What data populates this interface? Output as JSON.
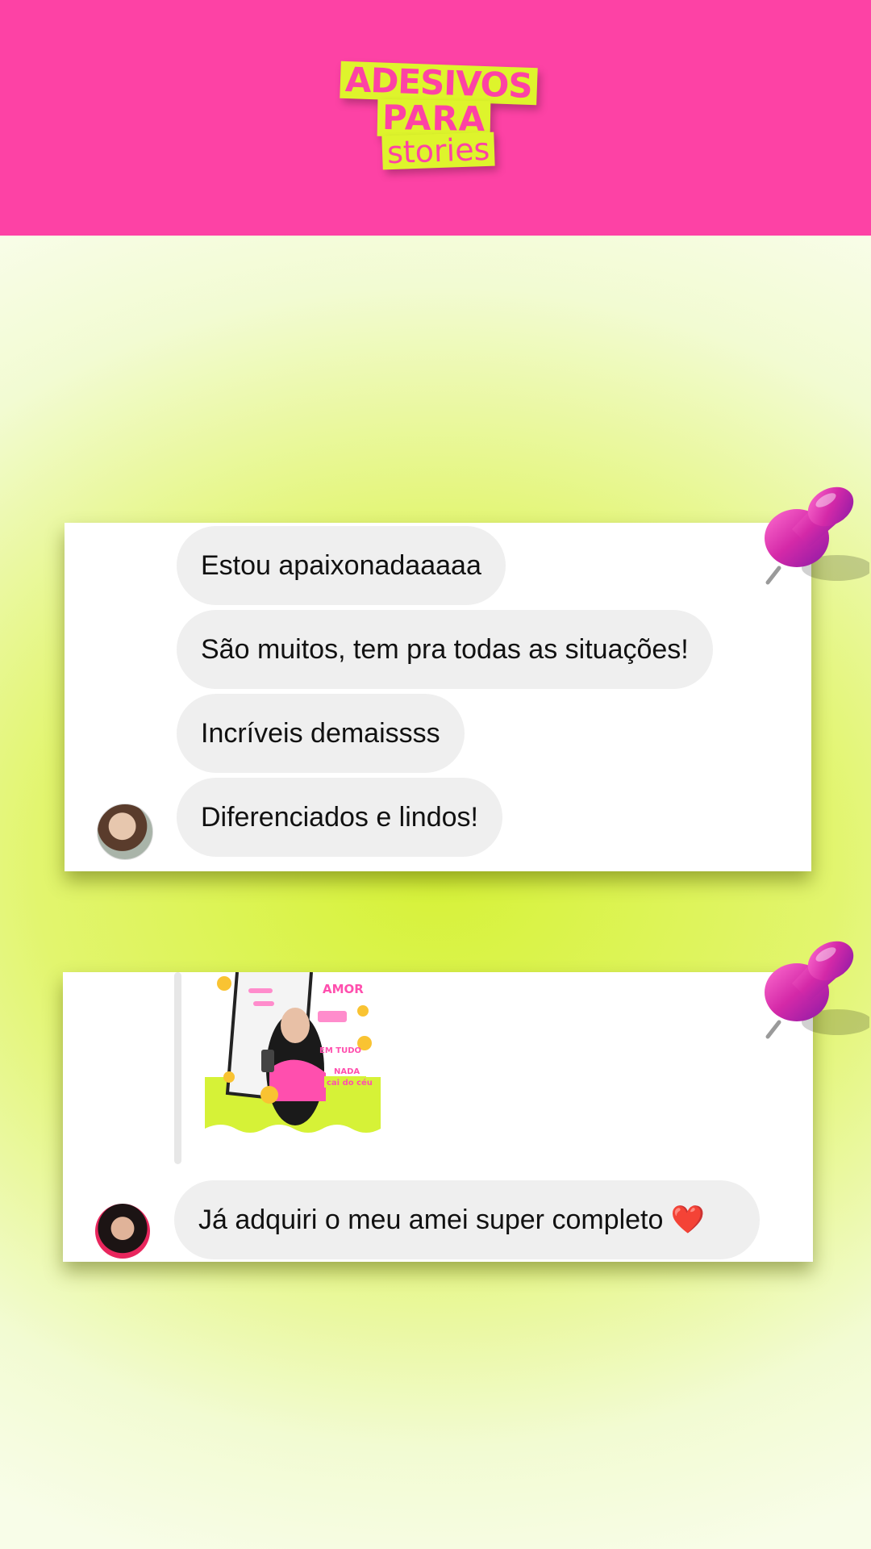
{
  "header": {
    "background": "#fd42a5",
    "logo": {
      "line1": "ADESIVOS",
      "line2": "PARA",
      "line3": "stories"
    }
  },
  "card1": {
    "messages": [
      "Estou apaixonadaaaaa",
      "São muitos, tem pra todas as situações!",
      "Incríveis demaissss",
      "Diferenciados e lindos!"
    ]
  },
  "card2": {
    "preview_stickers": [
      "AMOR",
      "EM TUDO",
      "NADA",
      "cai do céu"
    ],
    "message": "Já adquiri o meu amei super completo ❤️"
  },
  "colors": {
    "accent_pink": "#fd42a5",
    "accent_lime": "#def42c",
    "bubble": "#efefef"
  }
}
